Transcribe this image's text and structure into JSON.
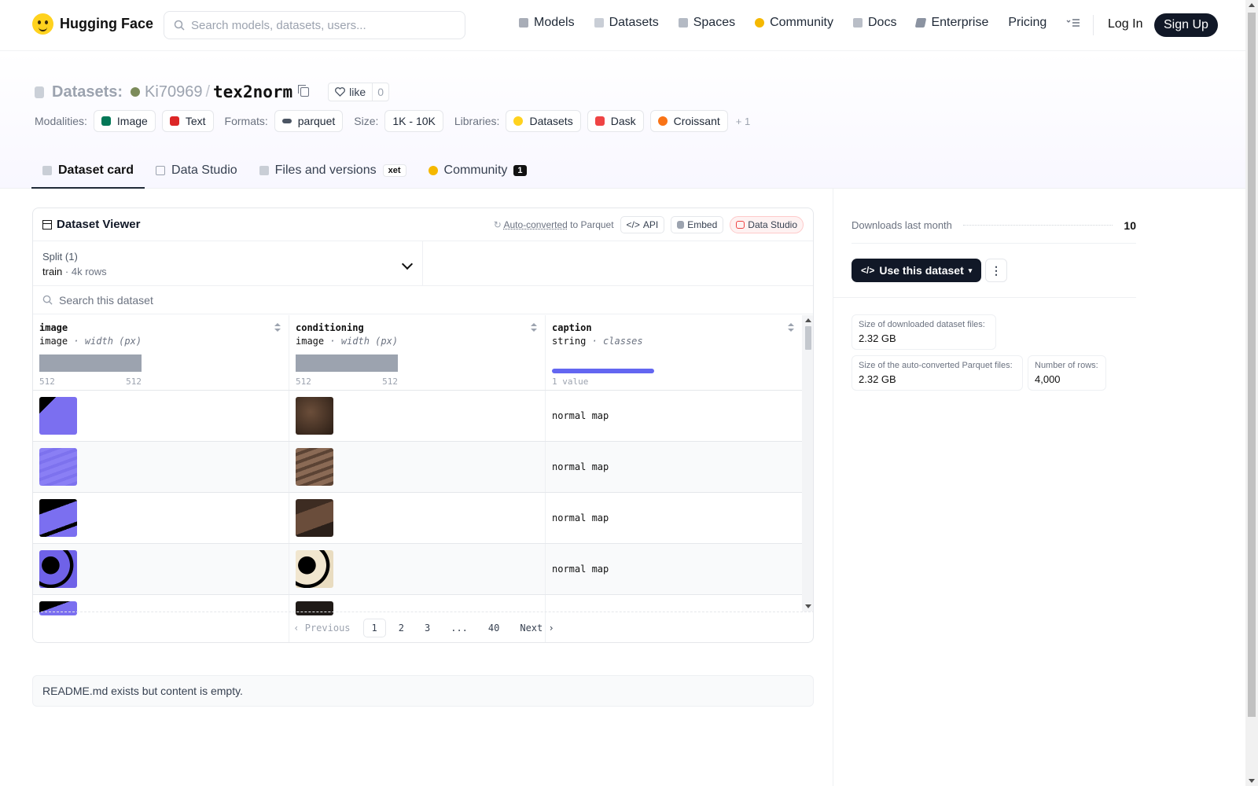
{
  "brand": {
    "name": "Hugging Face"
  },
  "search": {
    "placeholder": "Search models, datasets, users..."
  },
  "nav": {
    "items": [
      {
        "label": "Models",
        "icon": "models-icon",
        "color": "#a8adb7"
      },
      {
        "label": "Datasets",
        "icon": "datasets-icon",
        "color": "#c9ced6"
      },
      {
        "label": "Spaces",
        "icon": "spaces-icon",
        "color": "#b4bac4"
      },
      {
        "label": "Community",
        "icon": "community-icon",
        "color": "#F5B800"
      },
      {
        "label": "Docs",
        "icon": "docs-icon",
        "color": "#b9bec7"
      },
      {
        "label": "Enterprise",
        "icon": "enterprise-icon",
        "color": "#8b93a1"
      },
      {
        "label": "Pricing",
        "icon": "",
        "color": ""
      }
    ],
    "login": "Log In",
    "signup": "Sign Up"
  },
  "repo": {
    "type_label": "Datasets:",
    "owner": "Ki70969",
    "name": "tex2norm",
    "like_label": "like",
    "like_count": "0"
  },
  "tags": {
    "modalities_label": "Modalities:",
    "modalities": [
      {
        "label": "Image",
        "color": "#047857"
      },
      {
        "label": "Text",
        "color": "#dc2626"
      }
    ],
    "formats_label": "Formats:",
    "formats": [
      {
        "label": "parquet"
      }
    ],
    "size_label": "Size:",
    "size": "1K - 10K",
    "libraries_label": "Libraries:",
    "libraries": [
      {
        "label": "Datasets",
        "color": "#FFD21E"
      },
      {
        "label": "Dask",
        "color": "#ef4444"
      },
      {
        "label": "Croissant",
        "color": "#f97316"
      }
    ],
    "more": "+ 1"
  },
  "tabs": [
    {
      "label": "Dataset card",
      "active": true
    },
    {
      "label": "Data Studio"
    },
    {
      "label": "Files and versions",
      "badge": "xet"
    },
    {
      "label": "Community",
      "badge": "1"
    }
  ],
  "viewer": {
    "title": "Dataset Viewer",
    "autoconv_link": "Auto-converted",
    "autoconv_suffix": "to Parquet",
    "api": "API",
    "embed": "Embed",
    "studio": "Data Studio",
    "split_label": "Split (1)",
    "split_name": "train",
    "split_sep": "·",
    "split_rows": "4k rows",
    "search_placeholder": "Search this dataset",
    "columns": [
      {
        "name": "image",
        "type": "image",
        "stat": "width (px)",
        "min": "512",
        "max": "512"
      },
      {
        "name": "conditioning",
        "type": "image",
        "stat": "width (px)",
        "min": "512",
        "max": "512"
      },
      {
        "name": "caption",
        "type": "string",
        "stat": "classes",
        "summary": "1 value"
      }
    ],
    "rows": [
      {
        "img_color": "#7b6ff0",
        "cond_color": "#3d2a1e",
        "caption": "normal map"
      },
      {
        "img_color": "#8a7ff5",
        "cond_color": "#7a5b47",
        "caption": "normal map"
      },
      {
        "img_color": "#7b6ff0",
        "cond_color": "#4a3528",
        "caption": "normal map"
      },
      {
        "img_color": "#6f62e8",
        "cond_color": "#f1e6cf",
        "caption": "normal map"
      },
      {
        "img_color": "#7b6ff0",
        "cond_color": "#1f1a17",
        "caption": ""
      }
    ],
    "pager": {
      "prev": "Previous",
      "pages": [
        "1",
        "2",
        "3",
        "...",
        "40"
      ],
      "next": "Next"
    }
  },
  "readme": {
    "text": "README.md exists but content is empty."
  },
  "sidebar": {
    "downloads_label": "Downloads last month",
    "downloads_value": "10",
    "use_button": "Use this dataset",
    "stats": [
      {
        "label": "Size of downloaded dataset files:",
        "value": "2.32 GB"
      },
      {
        "label": "Size of the auto-converted Parquet files:",
        "value": "2.32 GB"
      },
      {
        "label": "Number of rows:",
        "value": "4,000"
      }
    ]
  }
}
